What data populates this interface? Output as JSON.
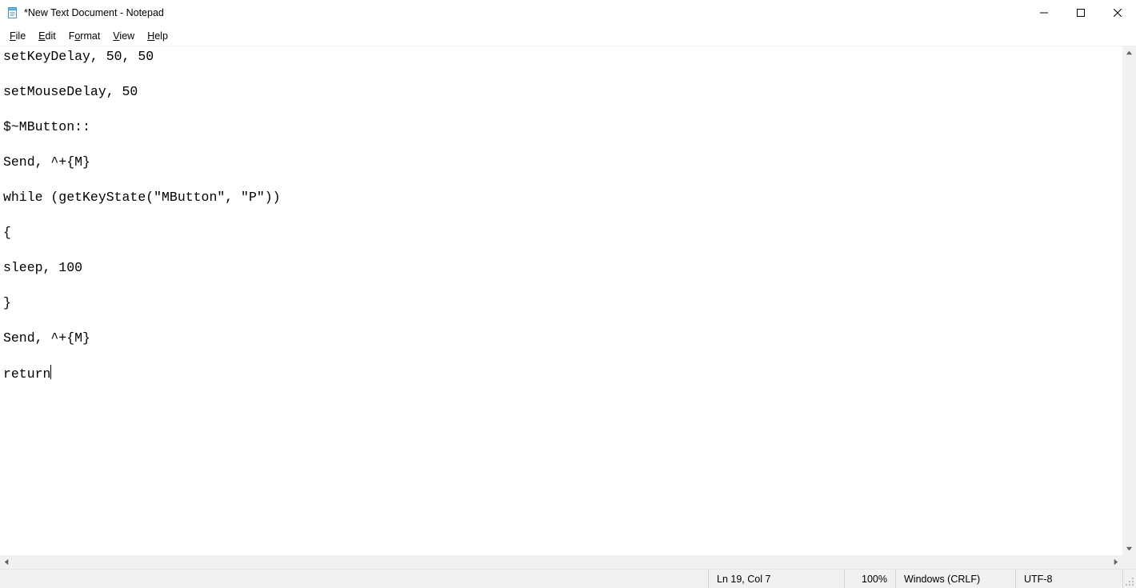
{
  "window": {
    "title": "*New Text Document - Notepad"
  },
  "menu": {
    "file": "File",
    "edit": "Edit",
    "format": "Format",
    "view": "View",
    "help": "Help"
  },
  "editor": {
    "content": "setKeyDelay, 50, 50\n\nsetMouseDelay, 50\n\n$~MButton::\n\nSend, ^+{M}\n\nwhile (getKeyState(\"MButton\", \"P\"))\n\n{\n\nsleep, 100\n\n}\n\nSend, ^+{M}\n\nreturn"
  },
  "status": {
    "position": "Ln 19, Col 7",
    "zoom": "100%",
    "line_ending": "Windows (CRLF)",
    "encoding": "UTF-8"
  }
}
